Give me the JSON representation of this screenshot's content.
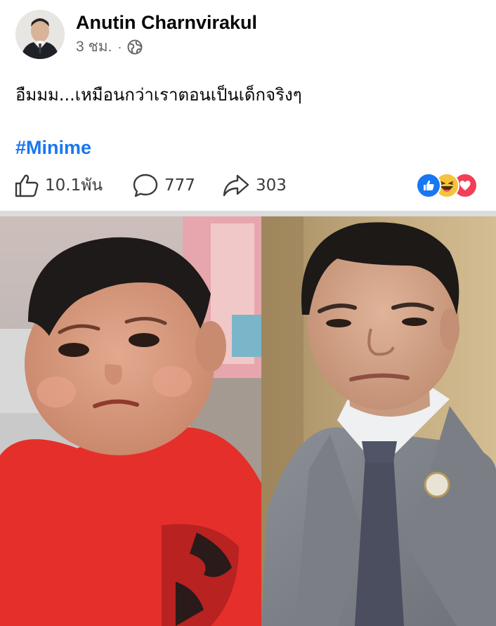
{
  "post": {
    "author": "Anutin Charnvirakul",
    "time": "3 ชม.",
    "separator": "·",
    "privacy_icon": "globe-icon",
    "text": "อืมมม...เหมือนกว่าเราตอนเป็นเด็กจริงๆ",
    "hashtag": "#Minime"
  },
  "stats": {
    "likes": "10.1พัน",
    "comments": "777",
    "shares": "303",
    "reactions": [
      "like-reaction-icon",
      "haha-reaction-icon",
      "love-reaction-icon"
    ]
  },
  "colors": {
    "link": "#1877f2",
    "meta_text": "#65676b",
    "like_blue": "#1877f2",
    "haha_yellow": "#f7c33b",
    "love_red": "#f33e58",
    "divider": "#dcdcdc"
  }
}
